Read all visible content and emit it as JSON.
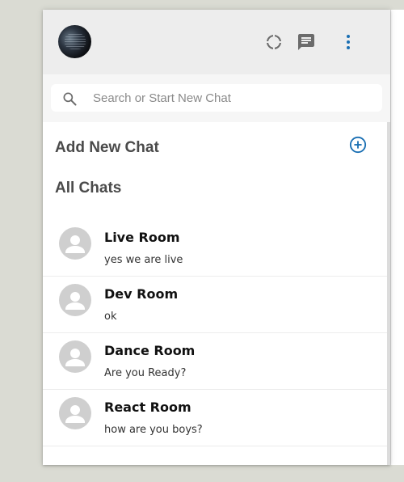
{
  "header": {
    "avatar": "profile-avatar",
    "icons": [
      "status-icon",
      "new-chat-icon",
      "menu-icon"
    ]
  },
  "search": {
    "placeholder": "Search or Start New Chat"
  },
  "sidebar": {
    "add_new_chat": "Add New Chat",
    "all_chats": "All Chats"
  },
  "chats": [
    {
      "name": "Live Room",
      "last_message": "yes we are live"
    },
    {
      "name": "Dev Room",
      "last_message": "ok"
    },
    {
      "name": "Dance Room",
      "last_message": "Are you Ready?"
    },
    {
      "name": "React Room",
      "last_message": "how are you boys?"
    }
  ],
  "colors": {
    "background": "#dadbd3",
    "header": "#ededed",
    "accent": "#1a6fb3",
    "icon_gray": "#6b6b6b",
    "avatar_placeholder": "#cfcfcf"
  }
}
